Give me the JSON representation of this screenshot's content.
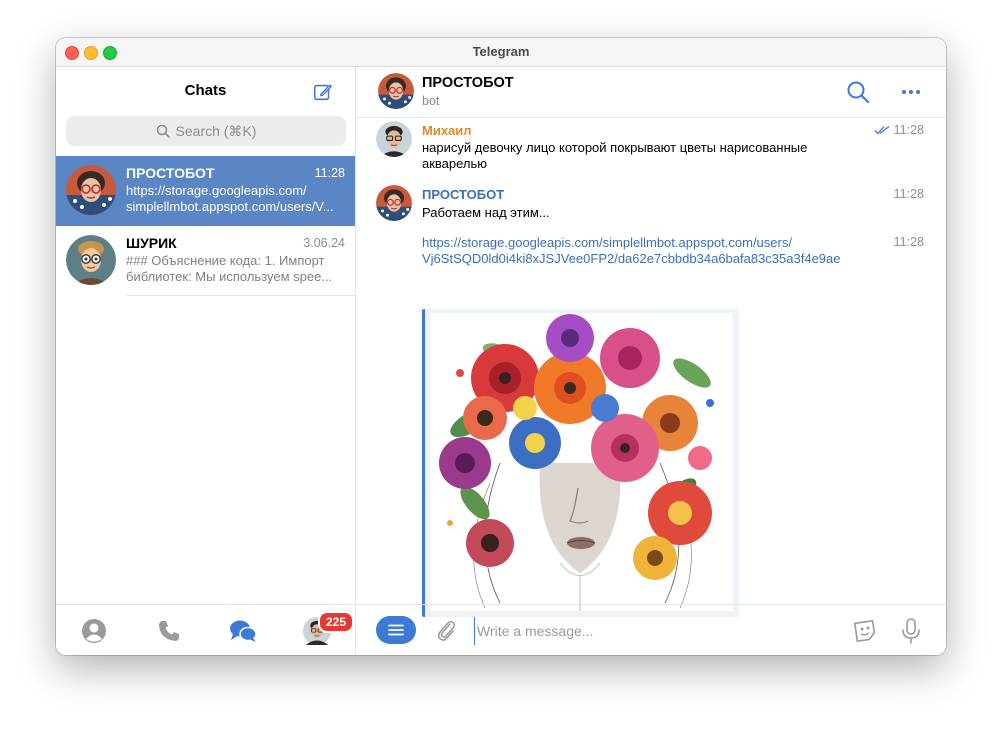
{
  "window": {
    "title": "Telegram"
  },
  "sidebar": {
    "title": "Chats",
    "search": {
      "placeholder": "Search (⌘K)"
    },
    "chats": [
      {
        "name": "ПРОСТОБОТ",
        "time": "11:28",
        "preview_line1": "https://storage.googleapis.com/",
        "preview_line2": "simplellmbot.appspot.com/users/V...",
        "active": true
      },
      {
        "name": "ШУРИК",
        "time": "3.06.24",
        "preview_line1": "### Объяснение кода: 1. Импорт",
        "preview_line2": "библиотек: Мы используем spee...",
        "active": false
      }
    ],
    "nav": {
      "items": [
        "profile-icon",
        "calls-icon",
        "chats-icon",
        "account-avatar"
      ],
      "badge": "225"
    }
  },
  "chat": {
    "name": "ПРОСТОБОТ",
    "status": "bot",
    "messages": [
      {
        "sender": "Михаил",
        "sender_color": "#e08a2b",
        "text_line1": "нарисуй девочку лицо которой покрывают цветы нарисованные",
        "text_line2": "акварелью",
        "time": "11:28",
        "read": true
      },
      {
        "sender": "ПРОСТОБОТ",
        "sender_color": "#3a6fb8",
        "text": "Работаем над этим...",
        "time": "11:28"
      },
      {
        "link_line1": "https://storage.googleapis.com/simplellmbot.appspot.com/users/",
        "link_line2": "Vj6StSQD0ld0i4ki8xJSJVee0FP2/da62e7cbbdb34a6bafa83c35a3f4e9ae",
        "time": "11:28",
        "preview_image": "watercolor-flowers-face"
      }
    ],
    "composer": {
      "placeholder": "Write a message..."
    }
  },
  "colors": {
    "accent": "#3d7ad6",
    "active_chat_bg": "#5b86c5",
    "badge": "#e53935"
  }
}
